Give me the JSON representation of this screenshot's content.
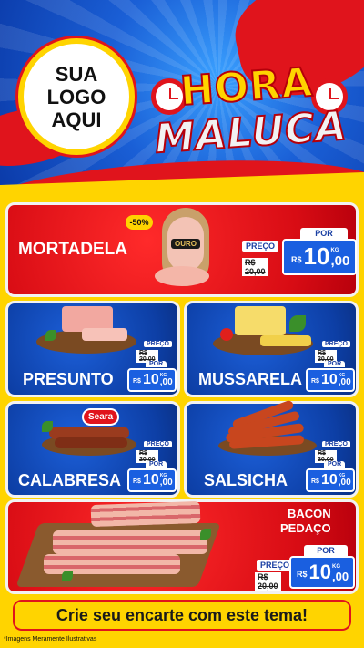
{
  "header": {
    "logo_text": "SUA\nLOGO\nAQUI",
    "title_line1": "HORA",
    "title_line2": "MALUCA"
  },
  "products": {
    "mortadela": {
      "name": "MORTADELA",
      "discount": "-50%",
      "brand": "OURO",
      "preco_label": "PREÇO",
      "old_price": "R$ 20,00",
      "por_label": "POR",
      "currency": "R$",
      "price_int": "10",
      "price_cents": ",00",
      "unit": "KG"
    },
    "presunto": {
      "name": "PRESUNTO",
      "preco_label": "PREÇO",
      "old_price": "R$ 20,00",
      "por_label": "POR",
      "currency": "R$",
      "price_int": "10",
      "price_cents": ",00",
      "unit": "KG"
    },
    "mussarela": {
      "name": "MUSSARELA",
      "preco_label": "PREÇO",
      "old_price": "R$ 20,00",
      "por_label": "POR",
      "currency": "R$",
      "price_int": "10",
      "price_cents": ",00",
      "unit": "KG"
    },
    "calabresa": {
      "name": "CALABRESA",
      "brand": "Seara",
      "preco_label": "PREÇO",
      "old_price": "R$ 20,00",
      "por_label": "POR",
      "currency": "R$",
      "price_int": "10",
      "price_cents": ",00",
      "unit": "KG"
    },
    "salsicha": {
      "name": "SALSICHA",
      "preco_label": "PREÇO",
      "old_price": "R$ 20,00",
      "por_label": "POR",
      "currency": "R$",
      "price_int": "10",
      "price_cents": ",00",
      "unit": "KG"
    },
    "bacon": {
      "name_line1": "BACON",
      "name_line2": "PEDAÇO",
      "preco_label": "PREÇO",
      "old_price": "R$ 20,00",
      "por_label": "POR",
      "currency": "R$",
      "price_int": "10",
      "price_cents": ",00",
      "unit": "KG"
    }
  },
  "cta": {
    "text": "Crie seu encarte com este tema!"
  },
  "footer": {
    "note": "*Imagens Meramente Ilustrativas"
  },
  "colors": {
    "brand_red": "#e0141c",
    "brand_blue": "#1a5fe0",
    "brand_yellow": "#ffd400"
  }
}
